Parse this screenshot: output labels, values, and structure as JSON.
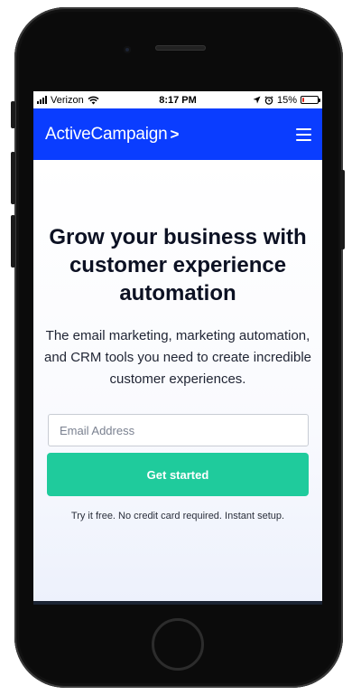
{
  "status_bar": {
    "carrier": "Verizon",
    "time": "8:17 PM",
    "battery_percent": "15%",
    "battery_level": 0.15,
    "battery_color": "#e0241b",
    "icons": [
      "signal-icon",
      "wifi-icon",
      "location-icon",
      "alarm-icon",
      "battery-icon"
    ]
  },
  "navbar": {
    "brand": "ActiveCampaign",
    "brand_mark": ">",
    "background": "#0a3dff",
    "menu_icon": "hamburger-menu-icon"
  },
  "hero": {
    "headline": "Grow your business with customer experience automation",
    "subheadline": "The email marketing, marketing automation, and CRM tools you need to create incredible customer experiences.",
    "email_placeholder": "Email Address",
    "email_value": "",
    "cta_label": "Get started",
    "cta_color": "#1fcb9c",
    "note": "Try it free. No credit card required. Instant setup."
  }
}
